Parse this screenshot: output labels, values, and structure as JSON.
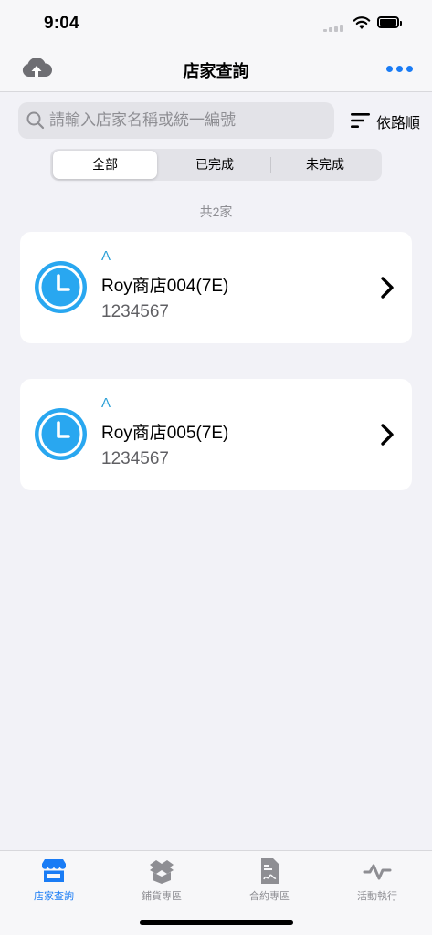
{
  "status_bar": {
    "time": "9:04"
  },
  "nav": {
    "title": "店家查詢",
    "upload_icon": "cloud-upload-icon",
    "more_icon": "more-icon"
  },
  "search": {
    "placeholder": "請輸入店家名稱或統一編號",
    "value": ""
  },
  "sort": {
    "label": "依路順",
    "icon": "sort-lines-icon"
  },
  "filter": {
    "segments": [
      {
        "label": "全部",
        "selected": true
      },
      {
        "label": "已完成",
        "selected": false
      },
      {
        "label": "未完成",
        "selected": false
      }
    ]
  },
  "result_count": "共2家",
  "stores": [
    {
      "group": "A",
      "name": "Roy商店004(7E)",
      "code": "1234567",
      "status_icon": "clock-icon"
    },
    {
      "group": "A",
      "name": "Roy商店005(7E)",
      "code": "1234567",
      "status_icon": "clock-icon"
    }
  ],
  "tabs": [
    {
      "label": "店家查詢",
      "icon": "store-icon",
      "active": true
    },
    {
      "label": "鋪貨專區",
      "icon": "box-icon",
      "active": false
    },
    {
      "label": "合約專區",
      "icon": "contract-icon",
      "active": false
    },
    {
      "label": "活動執行",
      "icon": "activity-icon",
      "active": false
    }
  ],
  "colors": {
    "accent": "#1a7cf5",
    "clock_blue": "#29a7f0",
    "group_label": "#2a9fd6",
    "background": "#f2f2f7",
    "inactive_tab": "#8e8e93"
  }
}
